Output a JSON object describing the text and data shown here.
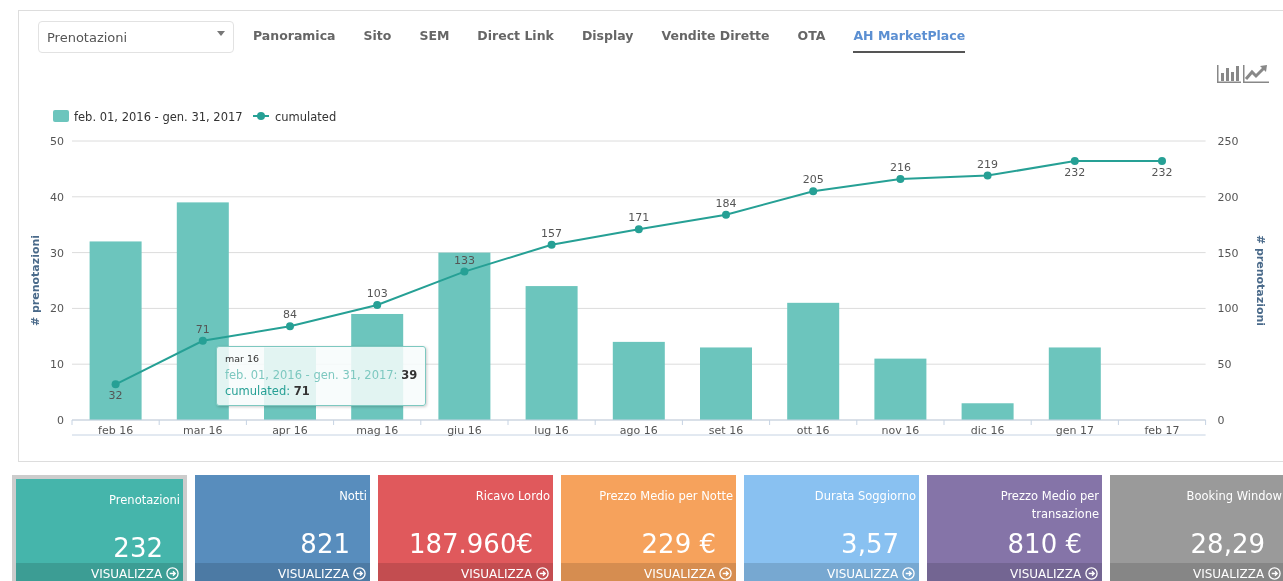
{
  "metric_select": {
    "value": "Prenotazioni"
  },
  "tabs": [
    {
      "label": "Panoramica",
      "selected": false
    },
    {
      "label": "Sito",
      "selected": false
    },
    {
      "label": "SEM",
      "selected": false
    },
    {
      "label": "Direct Link",
      "selected": false
    },
    {
      "label": "Display",
      "selected": false
    },
    {
      "label": "Vendite Dirette",
      "selected": false
    },
    {
      "label": "OTA",
      "selected": false
    },
    {
      "label": "AH MarketPlace",
      "selected": true
    }
  ],
  "chart": {
    "chart_data": {
      "type": "bar",
      "ylabel": "# prenotazioni",
      "categories": [
        "feb 16",
        "mar 16",
        "apr 16",
        "mag 16",
        "giu 16",
        "lug 16",
        "ago 16",
        "set 16",
        "ott 16",
        "nov 16",
        "dic 16",
        "gen 17",
        "feb 17"
      ],
      "series": [
        {
          "name": "feb. 01, 2016 - gen. 31, 2017",
          "color": "#6cc5bd",
          "values": [
            32,
            39,
            13,
            19,
            30,
            24,
            14,
            13,
            21,
            11,
            3,
            13,
            0
          ]
        },
        {
          "name": "cumulated",
          "type": "line",
          "axis": "y2",
          "marker": "circle",
          "color": "#26a095",
          "values": [
            32,
            71,
            84,
            103,
            133,
            157,
            171,
            184,
            205,
            216,
            219,
            232,
            232
          ],
          "value_labels": [
            "32",
            "71",
            "84",
            "103",
            "133",
            "157",
            "171",
            "184",
            "205",
            "216",
            "219",
            "232",
            "232"
          ]
        }
      ],
      "ylim": [
        0,
        50
      ],
      "yticks": [
        0,
        10,
        20,
        30,
        40,
        50
      ],
      "y2label": "# prenotazioni",
      "y2lim": [
        0,
        250
      ],
      "y2ticks": [
        0,
        50,
        100,
        150,
        200,
        250
      ],
      "grid": true,
      "legend": true
    },
    "tooltip": {
      "title": "mar 16",
      "series_label": "feb. 01, 2016 - gen. 31, 2017:",
      "series_value": "39",
      "cumulated_label": "cumulated:",
      "cumulated_value": "71"
    }
  },
  "cards": [
    {
      "title": "Prenotazioni",
      "value": "232",
      "link": "VISUALIZZA",
      "color": "#45b5ab",
      "selected": true
    },
    {
      "title": "Notti",
      "value": "821",
      "link": "VISUALIZZA",
      "color": "#588dbd",
      "selected": false
    },
    {
      "title": "Ricavo Lordo",
      "value": "187.960€",
      "link": "VISUALIZZA",
      "color": "#e0595c",
      "selected": false
    },
    {
      "title": "Prezzo Medio per Notte",
      "value": "229 €",
      "link": "VISUALIZZA",
      "color": "#f6a25c",
      "selected": false
    },
    {
      "title": "Durata Soggiorno",
      "value": "3,57",
      "link": "VISUALIZZA",
      "color": "#89c1f1",
      "selected": false
    },
    {
      "title": "Prezzo Medio per transazione",
      "value": "810 €",
      "link": "VISUALIZZA",
      "color": "#8574a8",
      "selected": false
    },
    {
      "title": "Booking Window",
      "value": "28,29",
      "link": "VISUALIZZA",
      "color": "#9a9a9a",
      "selected": false
    }
  ]
}
